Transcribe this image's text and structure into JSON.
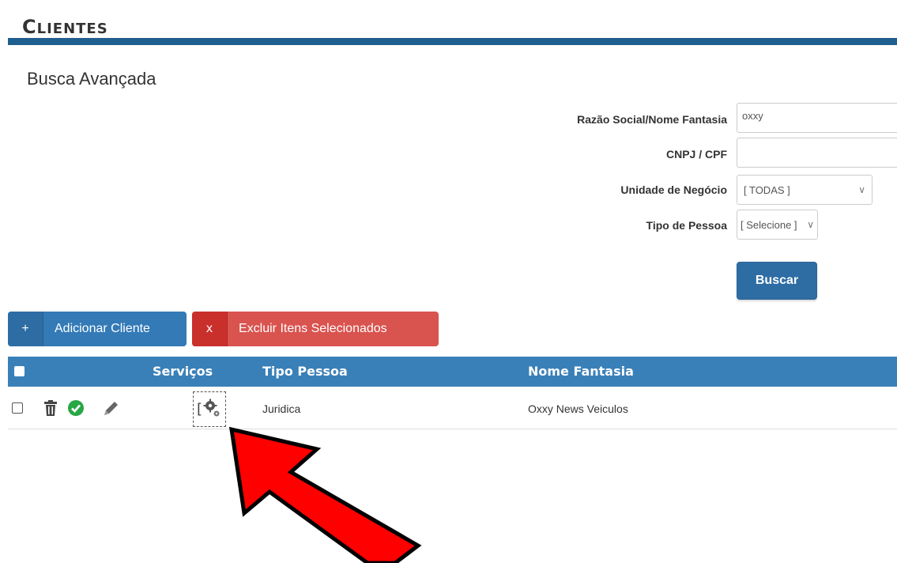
{
  "page": {
    "title_cap": "C",
    "title_rest": "LIENTES"
  },
  "search": {
    "title": "Busca Avançada",
    "fields": {
      "razao_label": "Razão Social/Nome Fantasia",
      "razao_value": "oxxy",
      "cnpj_label": "CNPJ / CPF",
      "cnpj_value": "",
      "unidade_label": "Unidade de Negócio",
      "unidade_value": "[ TODAS ]",
      "tipo_label": "Tipo de Pessoa",
      "tipo_value": "[ Selecione ]"
    },
    "submit_label": "Buscar"
  },
  "actions": {
    "add_icon": "+",
    "add_label": "Adicionar Cliente",
    "delete_icon": "x",
    "delete_label": "Excluir Itens Selecionados"
  },
  "table": {
    "headers": {
      "servicos": "Serviços",
      "tipo_pessoa": "Tipo Pessoa",
      "nome_fantasia": "Nome Fantasia"
    },
    "rows": [
      {
        "tipo_pessoa": "Juridica",
        "nome_fantasia": "Oxxy News Veiculos",
        "icons": [
          "trash-icon",
          "check-circle-icon",
          "pencil-icon",
          "gears-icon"
        ]
      }
    ]
  },
  "colors": {
    "title_bar": "#1f5f8f",
    "table_header": "#3a80b8",
    "primary": "#337ab7",
    "danger": "#d9534f",
    "success": "#28a745",
    "annotation_arrow": "#ff0000"
  }
}
